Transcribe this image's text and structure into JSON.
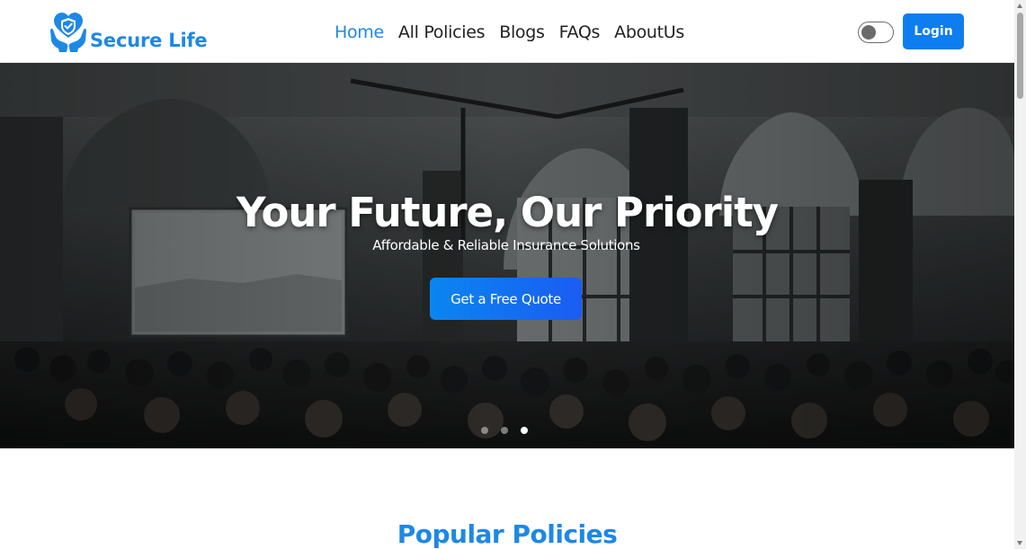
{
  "brand": {
    "name": "Secure Life",
    "accent_color": "#1e88e5",
    "icon": "hands-heart-shield-icon"
  },
  "nav": {
    "links": [
      {
        "label": "Home",
        "active": true
      },
      {
        "label": "All Policies",
        "active": false
      },
      {
        "label": "Blogs",
        "active": false
      },
      {
        "label": "FAQs",
        "active": false
      },
      {
        "label": "AboutUs",
        "active": false
      }
    ],
    "theme_toggle": {
      "state": "off"
    },
    "login_label": "Login"
  },
  "hero": {
    "title": "Your Future, Our Priority",
    "subtitle": "Affordable & Reliable Insurance Solutions",
    "cta_label": "Get a Free Quote",
    "carousel": {
      "slide_count": 3,
      "active_slide": 3
    },
    "background": "conference-hall-crowd-photo"
  },
  "sections": {
    "popular_policies_title": "Popular Policies"
  },
  "colors": {
    "login_button": "#0d7df0",
    "cta_gradient_start": "#0b86f0",
    "cta_gradient_end": "#1a5cf2"
  }
}
